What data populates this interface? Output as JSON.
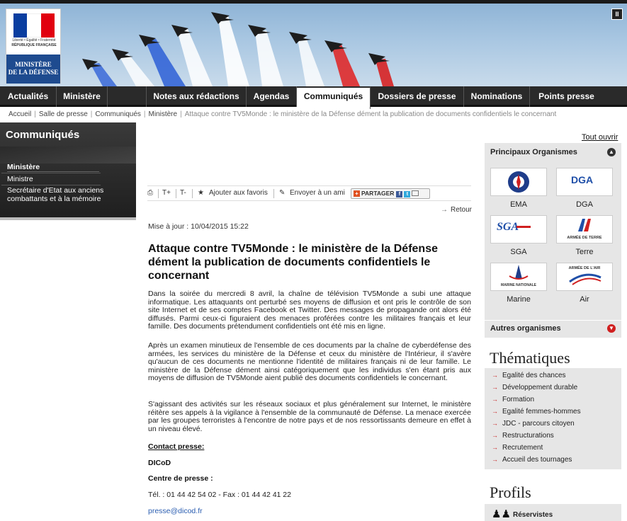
{
  "header": {
    "logo": {
      "motto": "Liberté • Égalité • Fraternité",
      "republic": "RÉPUBLIQUE FRANÇAISE",
      "ministry_line1": "MINISTÈRE",
      "ministry_line2": "DE LA DÉFENSE"
    },
    "pause_label": "II"
  },
  "nav": {
    "items": [
      "Actualités",
      "Ministère",
      "Notes aux rédactions",
      "Agendas",
      "Communiqués",
      "Dossiers de presse",
      "Nominations",
      "Points presse"
    ],
    "active": "Communiqués"
  },
  "breadcrumb": [
    "Accueil",
    "Salle de presse",
    "Communiqués",
    "Ministère",
    "Attaque contre TV5Monde : le ministère de la Défense dément la publication de documents confidentiels le concernant"
  ],
  "left_sidebar": {
    "title": "Communiqués",
    "items": [
      "Ministère",
      "Ministre",
      "Secrétaire d'Etat aux anciens",
      "combattants et à la mémoire"
    ]
  },
  "toolbar": {
    "text_plus": "T+",
    "text_minus": "T-",
    "favorites": "Ajouter aux favoris",
    "send": "Envoyer à un ami",
    "share": "PARTAGER"
  },
  "article": {
    "back": "Retour",
    "updated": "Mise à jour : 10/04/2015 15:22",
    "title": "Attaque contre TV5Monde : le ministère de la Défense dément la publication de documents confidentiels le concernant",
    "paragraphs": [
      "Dans la soirée du mercredi 8 avril, la chaîne de télévision TV5Monde a subi une attaque informatique. Les attaquants ont perturbé ses moyens de diffusion et ont pris le contrôle de son site Internet et de ses comptes Facebook et Twitter. Des messages de propagande ont alors été diffusés. Parmi ceux-ci figuraient des menaces proférées contre les militaires français et leur famille. Des documents prétendument confidentiels ont été mis en ligne.",
      "Après un examen minutieux de l'ensemble de ces documents par la chaîne de cyberdéfense des armées, les services du ministère de la Défense et ceux du ministère de l'Intérieur, il s'avère qu'aucun de ces documents ne mentionne l'identité de militaires français ni de leur famille. Le ministère de la Défense dément ainsi catégoriquement que les individus s'en étant pris aux moyens de diffusion de TV5Monde aient publié des documents confidentiels le concernant.",
      "S'agissant des activités sur les réseaux sociaux et plus généralement sur Internet, le ministère réitère ses appels à la vigilance à l'ensemble de la communauté de Défense. La menace exercée par les groupes terroristes à l'encontre de notre pays et de nos ressortissants demeure en effet à un niveau élevé."
    ],
    "contact_label": "Contact presse:",
    "dicod": "DICoD",
    "centre_label": "Centre de presse :",
    "tel": "Tél. : 01 44 42 54 02 - Fax : 01 44 42 41 22",
    "email": "presse@dicod.fr"
  },
  "right_sidebar": {
    "open_all": "Tout ouvrir",
    "principaux": "Principaux Organismes",
    "orgs": [
      {
        "name": "EMA",
        "logo_text": ""
      },
      {
        "name": "DGA",
        "logo_text": "DGA"
      },
      {
        "name": "SGA",
        "logo_text": "SGA"
      },
      {
        "name": "Terre",
        "logo_text": "ARMÉE DE TERRE"
      },
      {
        "name": "Marine",
        "logo_text": "MARINE NATIONALE"
      },
      {
        "name": "Air",
        "logo_text": "ARMÉE DE L'AIR"
      }
    ],
    "autres": "Autres organismes",
    "thematiques_title": "Thématiques",
    "thematiques": [
      "Egalité des chances",
      "Développement durable",
      "Formation",
      "Egalité femmes-hommes",
      "JDC - parcours citoyen",
      "Restructurations",
      "Recrutement",
      "Accueil des tournages"
    ],
    "profils_title": "Profils",
    "profils": [
      "Réservistes"
    ]
  },
  "colors": {
    "nav_bg": "#2a2a2a",
    "link_blue": "#2a5db0",
    "accent_red": "#c82020"
  }
}
